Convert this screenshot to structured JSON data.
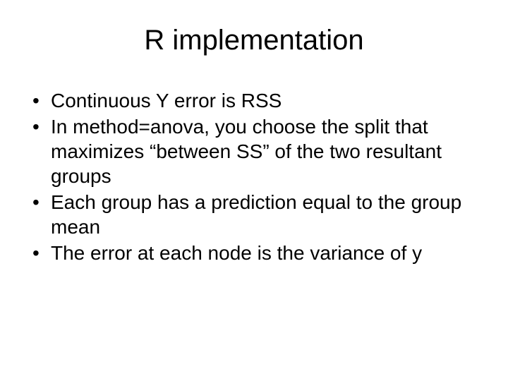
{
  "slide": {
    "title": "R implementation",
    "bullets": [
      "Continuous Y error is RSS",
      "In method=anova, you choose the split that maximizes “between SS” of the two resultant groups",
      "Each group has a prediction equal to the group mean",
      "The error at each node is the variance of y"
    ]
  }
}
